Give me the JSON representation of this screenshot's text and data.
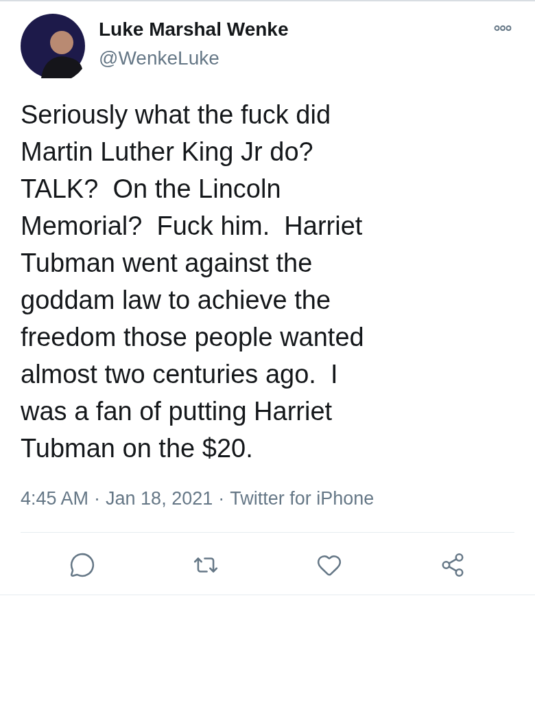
{
  "author": {
    "name": "Luke Marshal Wenke",
    "handle": "@WenkeLuke"
  },
  "tweet": {
    "lines": [
      "Seriously what the fuck did",
      "Martin Luther King Jr do?",
      "TALK?  On the Lincoln",
      "Memorial?  Fuck him.  Harriet",
      "Tubman went against the",
      "goddam law to achieve the",
      "freedom those people wanted",
      "almost two centuries ago.  I",
      "was a fan of putting Harriet",
      "Tubman on the $20."
    ]
  },
  "meta": {
    "time": "4:45 AM",
    "separator_1": "·",
    "date": "Jan 18, 2021",
    "separator_2": "·",
    "source": "Twitter for iPhone"
  }
}
